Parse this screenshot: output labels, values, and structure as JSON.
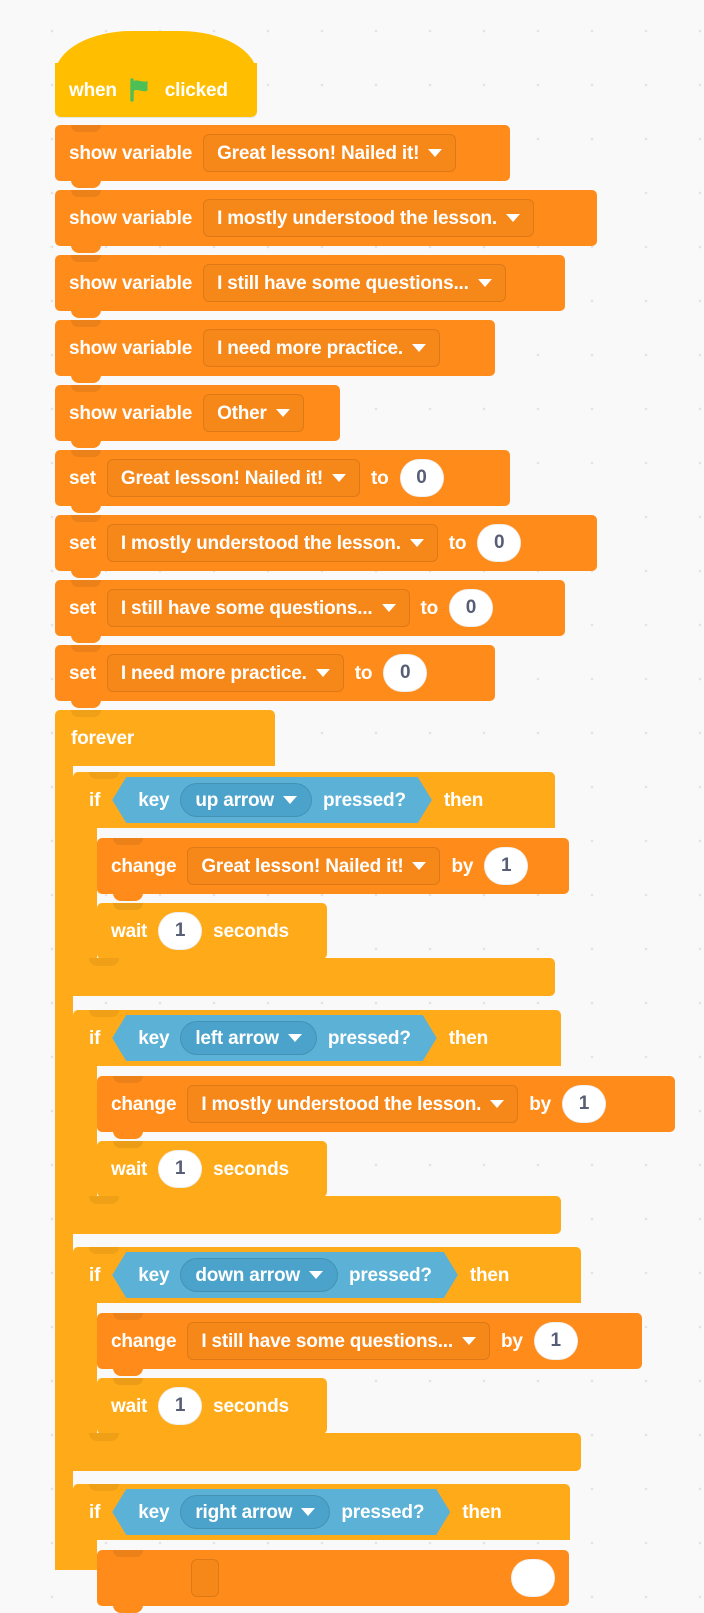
{
  "editor": {
    "background_color": "#F9F9F9",
    "colors": {
      "events": "#FFBF00",
      "data": "#FF8C1A",
      "control": "#FFAB19",
      "sensing": "#5CB1D6",
      "flag_green": "#4CBF56",
      "number_text": "#575E75"
    }
  },
  "variables": [
    "Great lesson! Nailed it!",
    "I mostly understood the lesson.",
    "I still have some questions...",
    "I need more practice.",
    "Other"
  ],
  "script": {
    "hat": {
      "word_when": "when",
      "icon": "green-flag-icon",
      "word_clicked": "clicked"
    },
    "show_variable_label": "show variable",
    "show_variable_blocks": [
      {
        "variable": "Great lesson! Nailed it!"
      },
      {
        "variable": "I mostly understood the lesson."
      },
      {
        "variable": "I still have some questions..."
      },
      {
        "variable": "I need more practice."
      },
      {
        "variable": "Other"
      }
    ],
    "set_label": "set",
    "to_label": "to",
    "set_blocks": [
      {
        "variable": "Great lesson! Nailed it!",
        "value": "0"
      },
      {
        "variable": "I mostly understood the lesson.",
        "value": "0"
      },
      {
        "variable": "I still have some questions...",
        "value": "0"
      },
      {
        "variable": "I need more practice.",
        "value": "0"
      }
    ],
    "forever_label": "forever",
    "if_label": "if",
    "then_label": "then",
    "key_label": "key",
    "pressed_label": "pressed?",
    "change_label": "change",
    "by_label": "by",
    "wait_label": "wait",
    "seconds_label": "seconds",
    "branches": [
      {
        "key": "up arrow",
        "variable": "Great lesson! Nailed it!",
        "change_by": "1",
        "wait_seconds": "1"
      },
      {
        "key": "left arrow",
        "variable": "I mostly understood the lesson.",
        "change_by": "1",
        "wait_seconds": "1"
      },
      {
        "key": "down arrow",
        "variable": "I still have some questions...",
        "change_by": "1",
        "wait_seconds": "1"
      },
      {
        "key": "right arrow",
        "variable": "",
        "change_by": "",
        "wait_seconds": ""
      }
    ]
  }
}
